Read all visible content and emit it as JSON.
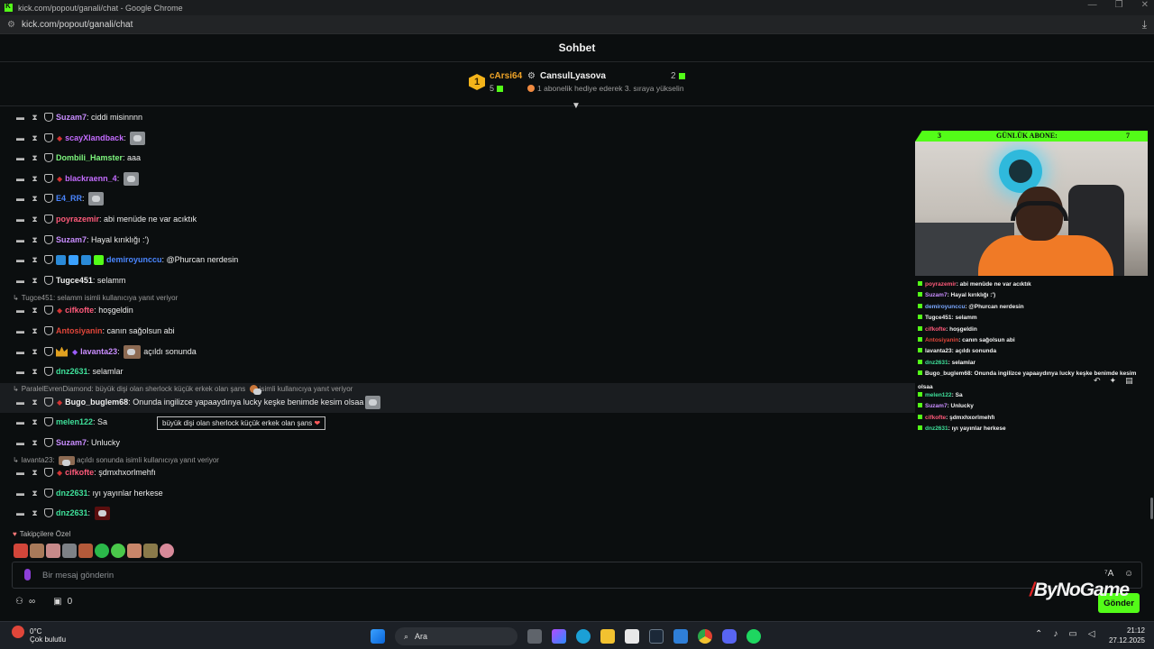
{
  "browser": {
    "window_title": "kick.com/popout/ganali/chat - Google Chrome",
    "url": "kick.com/popout/ganali/chat"
  },
  "chat": {
    "header": "Sohbet",
    "leaderboard": {
      "rank": "1",
      "top_user": "cArsi64",
      "top_count": "5",
      "target_user": "CansulLyasova",
      "target_count": "2",
      "hint": "1 abonelik hediye ederek 3. sıraya yükselin"
    },
    "messages": [
      {
        "user": "Suzam7",
        "color": "#c98dff",
        "text": "ciddi misinnnn"
      },
      {
        "user": "scayXlandback",
        "color": "#c46cff",
        "text": ""
      },
      {
        "user": "Dombili_Hamster",
        "color": "#7df57d",
        "text": "aaa"
      },
      {
        "user": "blackraenn_4",
        "color": "#c46cff",
        "text": ""
      },
      {
        "user": "E4_RR",
        "color": "#4a86ff",
        "text": ""
      },
      {
        "user": "poyrazemir",
        "color": "#ff5a7a",
        "text": "abi menüde ne var acıktık"
      },
      {
        "user": "Suzam7",
        "color": "#c98dff",
        "text": "Hayal kırıklığı :')"
      },
      {
        "user": "demiroyunccu",
        "color": "#4a86ff",
        "text": "@Phurcan nerdesin"
      },
      {
        "user": "Tugce451",
        "color": "#f1f1f1",
        "text": "selamm"
      },
      {
        "user": "cifkofte",
        "color": "#ff5a7a",
        "text": "hoşgeldin"
      },
      {
        "user": "Antosiyanin",
        "color": "#e0463a",
        "text": "canın sağolsun abi"
      },
      {
        "user": "lavanta23",
        "color": "#c98dff",
        "text": "açıldı sonunda"
      },
      {
        "user": "dnz2631",
        "color": "#3fe09a",
        "text": "selamlar"
      },
      {
        "user": "Bugo_buglem68",
        "color": "#f1f1f1",
        "text": "Onunda ingilizce yapaaydınya lucky keşke benimde kesim olsaa"
      },
      {
        "user": "melen122",
        "color": "#3fe09a",
        "text": "Sa"
      },
      {
        "user": "Suzam7",
        "color": "#c98dff",
        "text": "Unlucky"
      },
      {
        "user": "cifkofte",
        "color": "#ff5a7a",
        "text": "şdmxhxorlmehfı"
      },
      {
        "user": "dnz2631",
        "color": "#3fe09a",
        "text": "ıyı yayınlar herkese"
      },
      {
        "user": "dnz2631",
        "color": "#3fe09a",
        "text": ""
      }
    ],
    "replies": {
      "r1": "Tugce451: selamm isimli kullanıcıya yanıt veriyor",
      "r2": "ParalelEvrenDiamond: büyük dişi olan sherlock küçük erkek olan şans",
      "r2b": "isimli kullanıcıya yanıt veriyor",
      "r3a": "lavanta23:",
      "r3b": "açıldı sonunda isimli kullanıcıya yanıt veriyor"
    },
    "tooltip": "büyük dişi olan sherlock küçük erkek olan şans",
    "followers_label": "Takipçilere Özel",
    "input_placeholder": "Bir mesaj gönderin",
    "viewer_count": "0",
    "send_label": "Gönder"
  },
  "overlay": {
    "banner_left": "3",
    "banner_title": "GÜNLÜK ABONE:",
    "banner_right": "7",
    "brand": "ByNoGame",
    "chat": [
      {
        "u": "poyrazemir",
        "c": "#ff5a7a",
        "t": ": abi menüde ne var acıktık"
      },
      {
        "u": "Suzam7",
        "c": "#c98dff",
        "t": ": Hayal kırıklığı :')"
      },
      {
        "u": "demiroyunccu",
        "c": "#7aa8ff",
        "t": ": @Phurcan nerdesin"
      },
      {
        "u": "Tugce451",
        "c": "#f1f1f1",
        "t": ": selamm"
      },
      {
        "u": "cifkofte",
        "c": "#ff5a7a",
        "t": ": hoşgeldin"
      },
      {
        "u": "Antosiyanin",
        "c": "#e0463a",
        "t": ": canın sağolsun abi"
      },
      {
        "u": "lavanta23",
        "c": "#f1f1f1",
        "t": ": açıldı sonunda"
      },
      {
        "u": "dnz2631",
        "c": "#3fe09a",
        "t": ": selamlar"
      },
      {
        "u": "Bugo_buglem68",
        "c": "#f1f1f1",
        "t": ": Onunda ingilizce yapaaydınya lucky keşke benimde kesim"
      },
      {
        "u": "",
        "c": "#f1f1f1",
        "t": "olsaa"
      },
      {
        "u": "melen122",
        "c": "#3fe09a",
        "t": ": Sa"
      },
      {
        "u": "Suzam7",
        "c": "#c98dff",
        "t": ": Unlucky"
      },
      {
        "u": "cifkofte",
        "c": "#ff5a7a",
        "t": ": şdmxhxorlmehfı"
      },
      {
        "u": "dnz2631",
        "c": "#3fe09a",
        "t": ": ıyı yayınlar herkese"
      }
    ]
  },
  "taskbar": {
    "temperature": "0°C",
    "weather": "Çok bulutlu",
    "search": "Ara",
    "time": "21:12",
    "date": "27.12.2025"
  },
  "colors": {
    "accent": "#53fc18",
    "background": "#0b0e0f"
  }
}
